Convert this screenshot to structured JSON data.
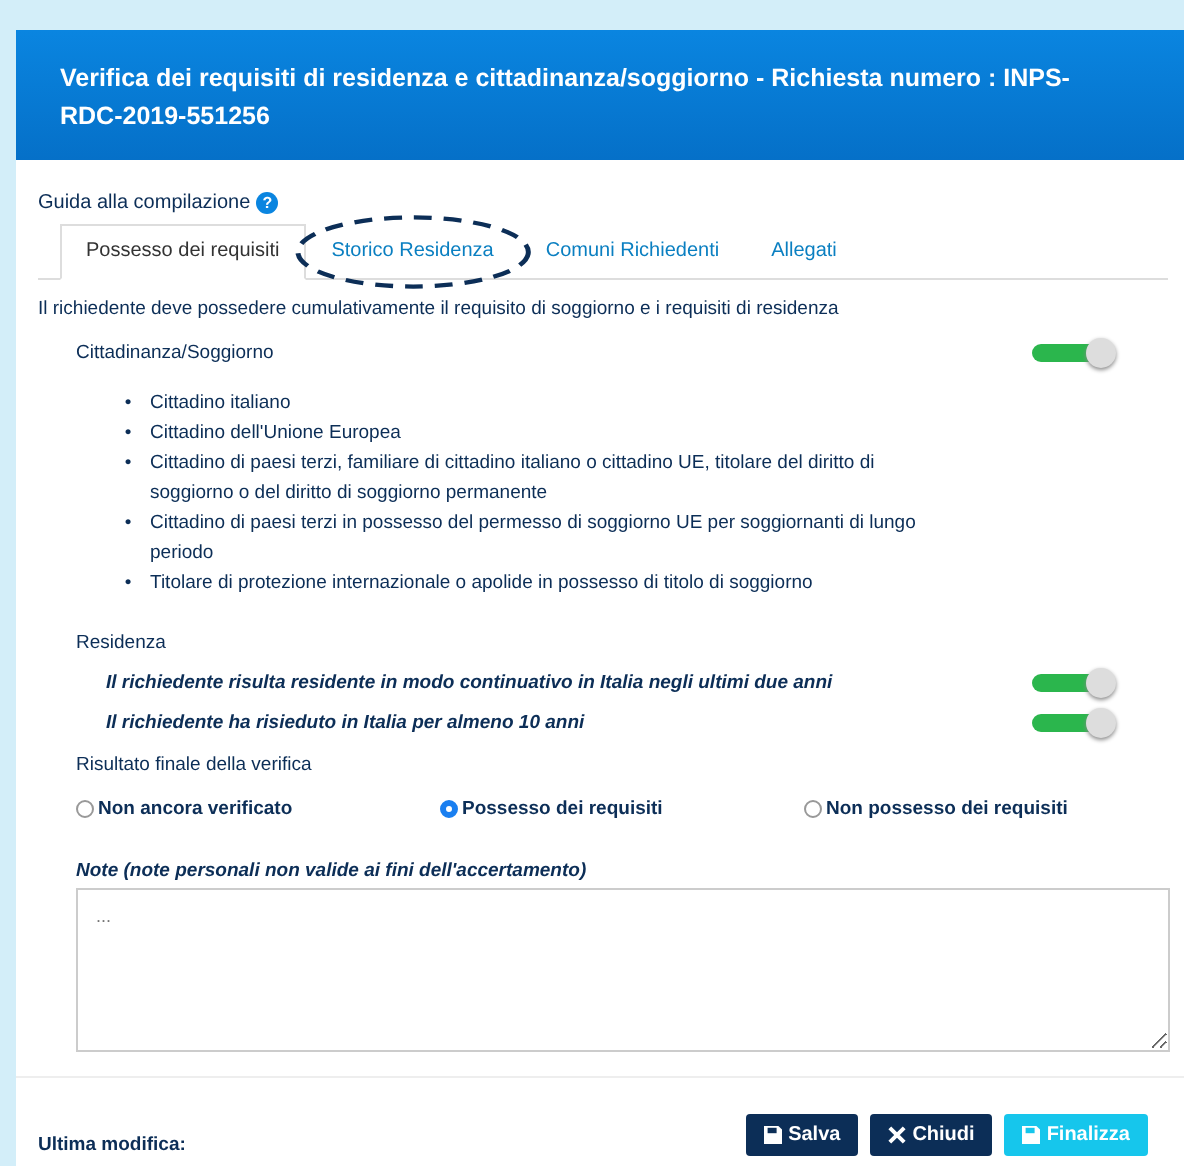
{
  "header": {
    "title": "Verifica dei requisiti di residenza e cittadinanza/soggiorno - Richiesta numero : INPS-RDC-2019-551256"
  },
  "guide": {
    "label": "Guida alla compilazione",
    "help": "?"
  },
  "tabs": [
    {
      "label": "Possesso dei requisiti",
      "selected": true,
      "circled": false
    },
    {
      "label": "Storico Residenza",
      "selected": false,
      "circled": true
    },
    {
      "label": "Comuni Richiedenti",
      "selected": false,
      "circled": false
    },
    {
      "label": "Allegati",
      "selected": false,
      "circled": false
    }
  ],
  "intro": "Il richiedente deve possedere cumulativamente il requisito di soggiorno e i requisiti di residenza",
  "citizenship": {
    "label": "Cittadinanza/Soggiorno",
    "on": true,
    "items": [
      {
        "marker": "•",
        "text": "Cittadino italiano"
      },
      {
        "marker": "•",
        "text": "Cittadino dell'Unione Europea"
      },
      {
        "marker": "•",
        "text": "Cittadino di paesi terzi, familiare di cittadino italiano o cittadino UE, titolare del diritto di soggiorno o del diritto di soggiorno permanente"
      },
      {
        "marker": "•",
        "text": "Cittadino di paesi terzi in possesso del permesso di soggiorno UE per soggiornanti di lungo periodo"
      },
      {
        "marker": "•",
        "text": "Titolare di protezione internazionale o apolide in possesso di titolo di soggiorno"
      }
    ]
  },
  "residence": {
    "label": "Residenza",
    "rows": [
      {
        "label": "Il richiedente risulta residente in modo continuativo in Italia negli ultimi due anni",
        "on": true
      },
      {
        "label": "Il richiedente ha risieduto in Italia per almeno 10 anni",
        "on": true
      }
    ]
  },
  "result": {
    "label": "Risultato finale della verifica",
    "options": [
      {
        "label": "Non ancora verificato",
        "selected": false
      },
      {
        "label": "Possesso dei requisiti",
        "selected": true
      },
      {
        "label": "Non possesso dei requisiti",
        "selected": false
      }
    ]
  },
  "notes": {
    "label": "Note (note personali non valide ai fini dell'accertamento)",
    "placeholder": "..."
  },
  "footer": {
    "label": "Ultima modifica:",
    "buttons": [
      {
        "label": "Salva",
        "kind": "save"
      },
      {
        "label": "Chiudi",
        "kind": "close"
      },
      {
        "label": "Finalizza",
        "kind": "finalize"
      }
    ]
  }
}
